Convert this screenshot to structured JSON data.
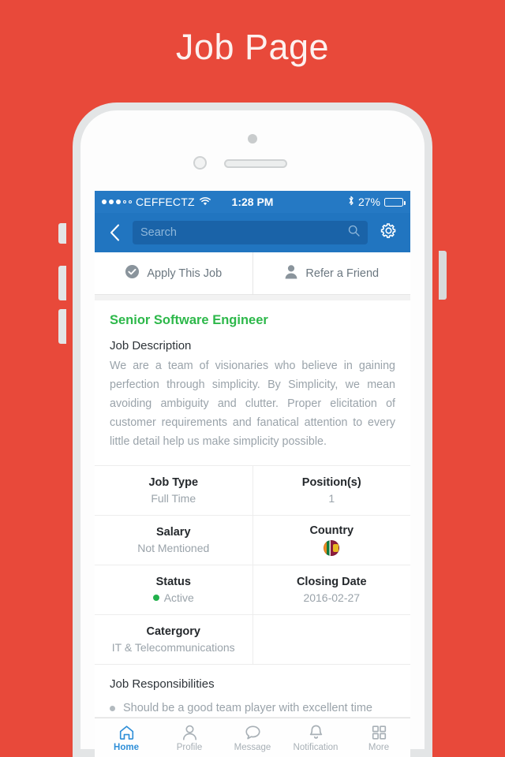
{
  "page": {
    "title": "Job Page",
    "background_color": "#e8493a"
  },
  "status_bar": {
    "carrier": "CEFFECTZ",
    "signal_dots_filled": 3,
    "signal_dots_total": 5,
    "wifi_icon": "wifi-icon",
    "time": "1:28 PM",
    "bluetooth_icon": "bluetooth-icon",
    "battery_percent": "27%",
    "battery_level": 27
  },
  "nav_bar": {
    "back_icon": "back-chevron-icon",
    "search": {
      "placeholder": "Search",
      "value": "",
      "icon": "search-icon"
    },
    "settings_icon": "gear-icon",
    "color": "#2175c0"
  },
  "actions": [
    {
      "label": "Apply This Job",
      "icon": "check-circle-icon"
    },
    {
      "label": "Refer a Friend",
      "icon": "person-icon"
    }
  ],
  "job": {
    "title": "Senior Software Engineer",
    "title_color": "#2db84a",
    "description_heading": "Job Description",
    "description": "We are a team of visionaries who believe in gaining perfection through simplicity. By Simplicity, we mean avoiding ambiguity and clutter. Proper elicitation of customer requirements and fanatical attention to every little detail help us make simplicity possible.",
    "details": [
      [
        {
          "label": "Job Type",
          "value": "Full Time"
        },
        {
          "label": "Position(s)",
          "value": "1"
        }
      ],
      [
        {
          "label": "Salary",
          "value": "Not Mentioned"
        },
        {
          "label": "Country",
          "value": "",
          "icon": "sri-lanka-flag-icon"
        }
      ],
      [
        {
          "label": "Status",
          "value": "Active",
          "status_color": "#22b14c"
        },
        {
          "label": "Closing Date",
          "value": "2016-02-27"
        }
      ],
      [
        {
          "label": "Catergory",
          "value": "IT & Telecommunications"
        },
        {
          "label": "",
          "value": ""
        }
      ]
    ],
    "responsibilities_heading": "Job Responsibilities",
    "responsibilities": [
      "Should be a good team player with excellent time"
    ]
  },
  "tab_bar": {
    "active_color": "#2f8fd8",
    "items": [
      {
        "label": "Home",
        "icon": "home-icon",
        "active": true
      },
      {
        "label": "Profile",
        "icon": "person-icon",
        "active": false
      },
      {
        "label": "Message",
        "icon": "chat-bubble-icon",
        "active": false
      },
      {
        "label": "Notification",
        "icon": "bell-icon",
        "active": false
      },
      {
        "label": "More",
        "icon": "grid-icon",
        "active": false
      }
    ]
  }
}
